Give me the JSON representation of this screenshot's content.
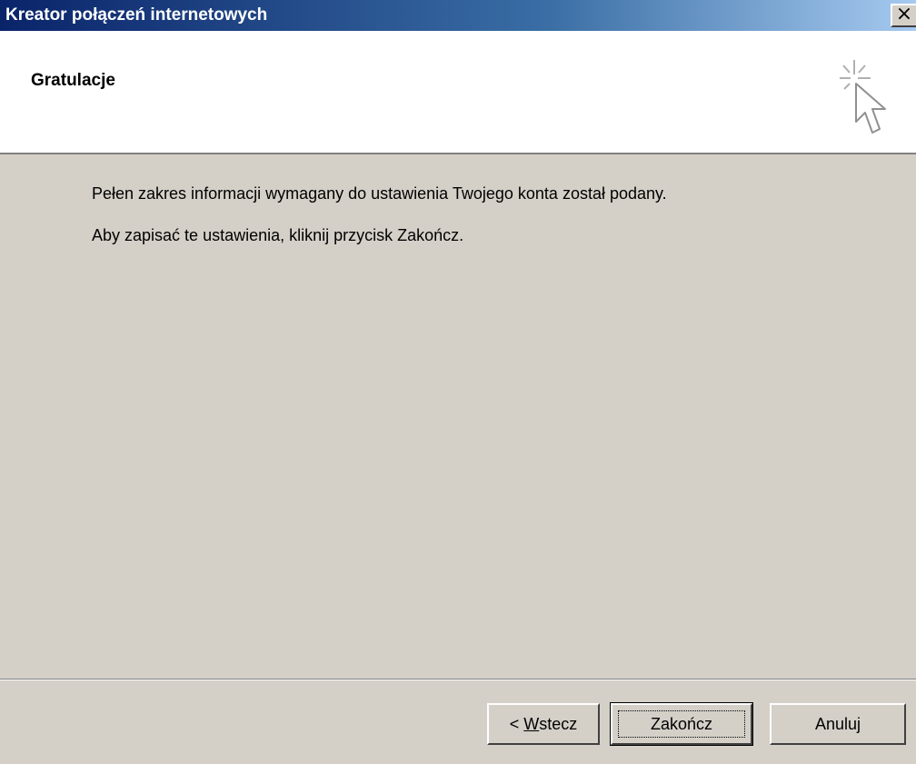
{
  "window": {
    "title": "Kreator połączeń internetowych",
    "close_glyph": "×"
  },
  "header": {
    "title": "Gratulacje",
    "icon": "wizard-cursor-icon"
  },
  "content": {
    "line1": "Pełen zakres informacji wymagany do ustawienia Twojego konta został podany.",
    "line2": "Aby zapisać te ustawienia, kliknij przycisk Zakończ."
  },
  "buttons": {
    "back_prefix": "< ",
    "back_accel": "W",
    "back_rest": "stecz",
    "finish": "Zakończ",
    "cancel": "Anuluj"
  },
  "colors": {
    "titlebar_start": "#0a246a",
    "titlebar_end": "#a6caf0",
    "dialog_bg": "#d4d0c8",
    "header_bg": "#ffffff"
  }
}
